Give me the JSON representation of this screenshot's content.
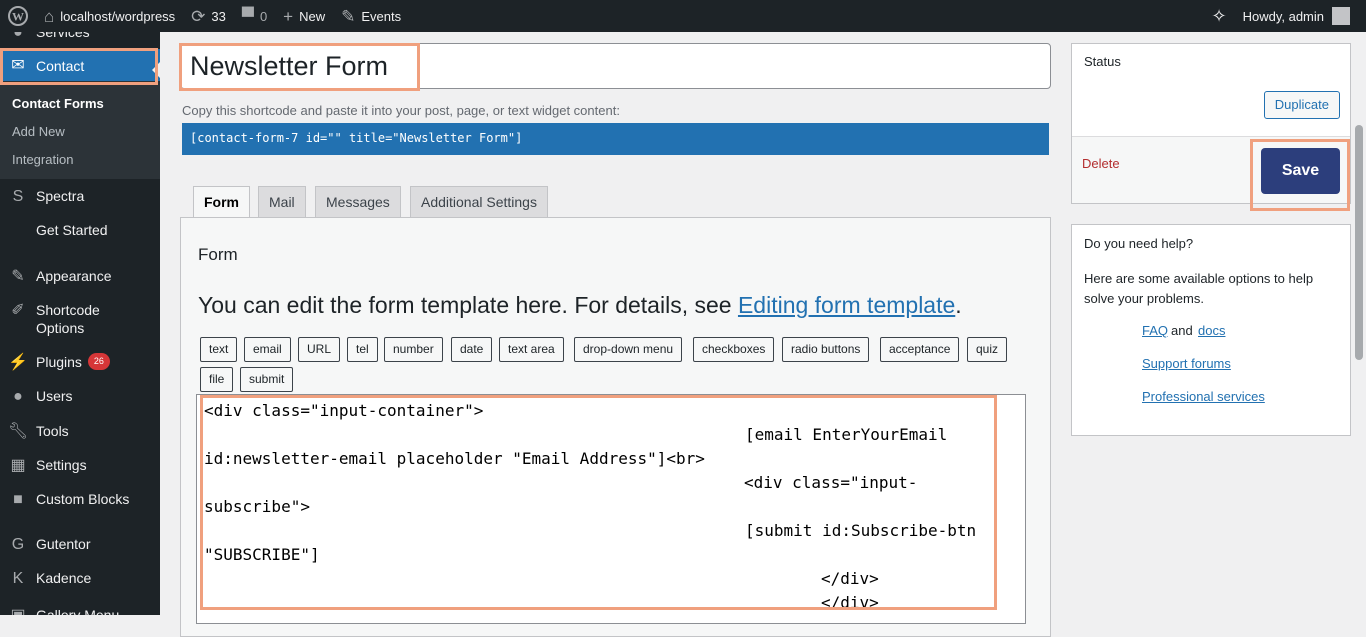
{
  "adminbar": {
    "site": "localhost/wordpress",
    "updates": "33",
    "comments": "0",
    "new": "New",
    "events": "Events",
    "howdy": "Howdy, admin"
  },
  "sidebar": {
    "items": [
      {
        "label": "Services"
      },
      {
        "label": "Contact"
      },
      {
        "label": "Spectra"
      },
      {
        "label": "Get Started"
      },
      {
        "label": "Appearance"
      },
      {
        "label": "Shortcode Options"
      },
      {
        "label": "Plugins",
        "badge": "26"
      },
      {
        "label": "Users"
      },
      {
        "label": "Tools"
      },
      {
        "label": "Settings"
      },
      {
        "label": "Custom Blocks"
      },
      {
        "label": "Gutentor"
      },
      {
        "label": "Kadence"
      },
      {
        "label": "Gallery Menu"
      }
    ],
    "submenu": [
      "Contact Forms",
      "Add New",
      "Integration"
    ]
  },
  "form": {
    "title": "Newsletter Form",
    "hint": "Copy this shortcode and paste it into your post, page, or text widget content:",
    "shortcode": "[contact-form-7 id=\"\" title=\"Newsletter Form\"]",
    "tabs": [
      "Form",
      "Mail",
      "Messages",
      "Additional Settings"
    ],
    "panel_heading": "Form",
    "panel_desc": "You can edit the form template here. For details, see ",
    "panel_link": "Editing form template",
    "panel_period": ".",
    "tag_buttons": [
      "text",
      "email",
      "URL",
      "tel",
      "number",
      "date",
      "text area",
      "drop-down menu",
      "checkboxes",
      "radio buttons",
      "acceptance",
      "quiz",
      "file",
      "submit"
    ],
    "code_lines": [
      "<div class=\"input-container\">",
      "[email EnterYourEmail",
      "id:newsletter-email placeholder \"Email Address\"]<br>",
      "<div class=\"input-",
      "subscribe\">",
      "[submit id:Subscribe-btn",
      "\"SUBSCRIBE\"]",
      "</div>",
      "</div>"
    ]
  },
  "status": {
    "heading": "Status",
    "duplicate": "Duplicate",
    "delete": "Delete",
    "save": "Save"
  },
  "help": {
    "heading": "Do you need help?",
    "text": "Here are some available options to help solve your problems.",
    "faq": "FAQ",
    "and": "and",
    "docs": "docs",
    "forums": "Support forums",
    "services": "Professional services"
  },
  "colors": {
    "highlight": "#f0a07e",
    "admin_blue": "#2271b1",
    "save_button": "#2c3e7c"
  }
}
